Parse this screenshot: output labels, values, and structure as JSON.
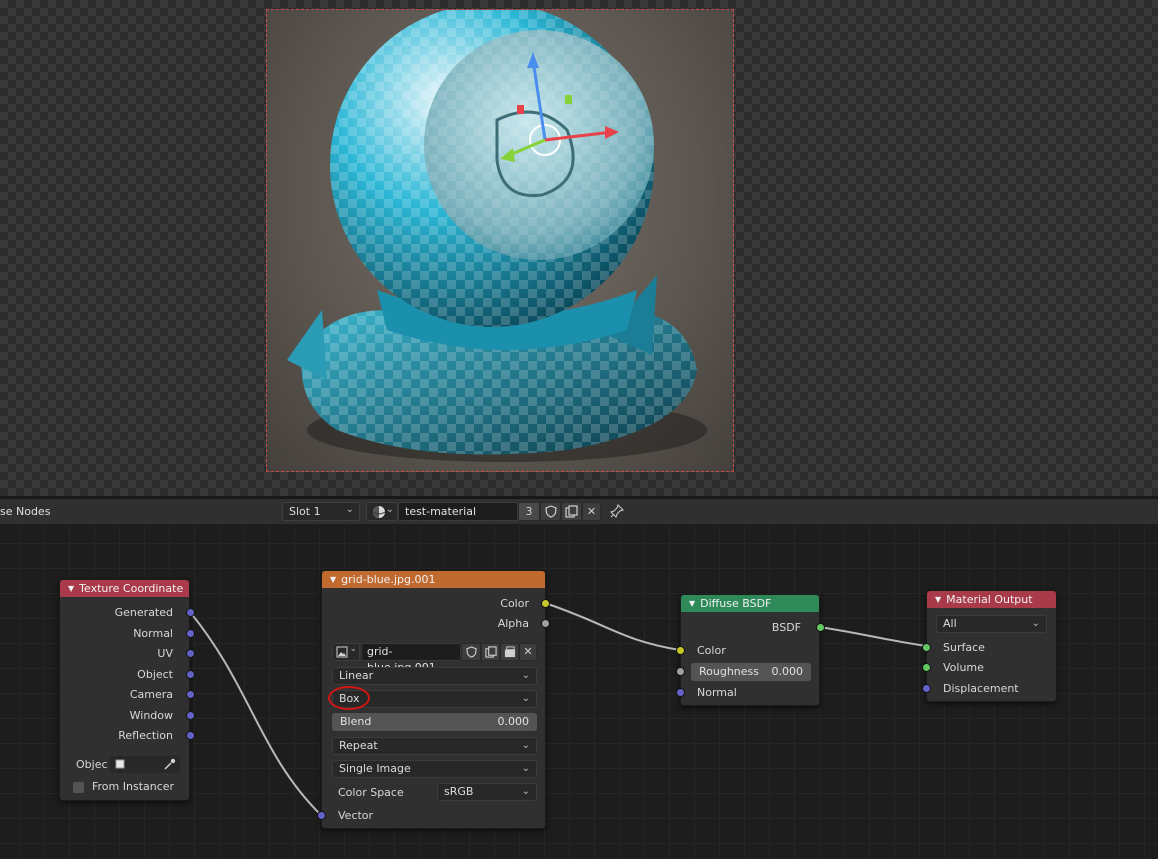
{
  "node_editor": {
    "header": {
      "title": "se Nodes",
      "slot": "Slot 1",
      "material_name": "test-material",
      "users_count": "3"
    }
  },
  "nodes": {
    "texture_coordinate": {
      "title": "Texture Coordinate",
      "header_color": "#a83a49",
      "outputs": [
        "Generated",
        "Normal",
        "UV",
        "Object",
        "Camera",
        "Window",
        "Reflection"
      ],
      "object_label": "Objec",
      "from_instancer": "From Instancer"
    },
    "image_texture": {
      "title": "grid-blue.jpg.001",
      "header_color": "#c06a30",
      "outputs": {
        "color": "Color",
        "alpha": "Alpha"
      },
      "image_name": "grid-blue.jpg.001",
      "interpolation": "Linear",
      "projection": "Box",
      "blend_label": "Blend",
      "blend_value": "0.000",
      "extension": "Repeat",
      "source": "Single Image",
      "color_space_label": "Color Space",
      "color_space_value": "sRGB",
      "input_vector": "Vector"
    },
    "diffuse_bsdf": {
      "title": "Diffuse BSDF",
      "header_color": "#2f8a5a",
      "output": "BSDF",
      "input_color": "Color",
      "roughness_label": "Roughness",
      "roughness_value": "0.000",
      "input_normal": "Normal"
    },
    "material_output": {
      "title": "Material Output",
      "header_color": "#a83a49",
      "target": "All",
      "inputs": [
        "Surface",
        "Volume",
        "Displacement"
      ]
    }
  },
  "icons": [
    "sphere-shading-icon",
    "shield-icon",
    "duplicate-icon",
    "close-icon",
    "pin-icon",
    "image-icon",
    "eyedropper-icon",
    "object-icon"
  ]
}
